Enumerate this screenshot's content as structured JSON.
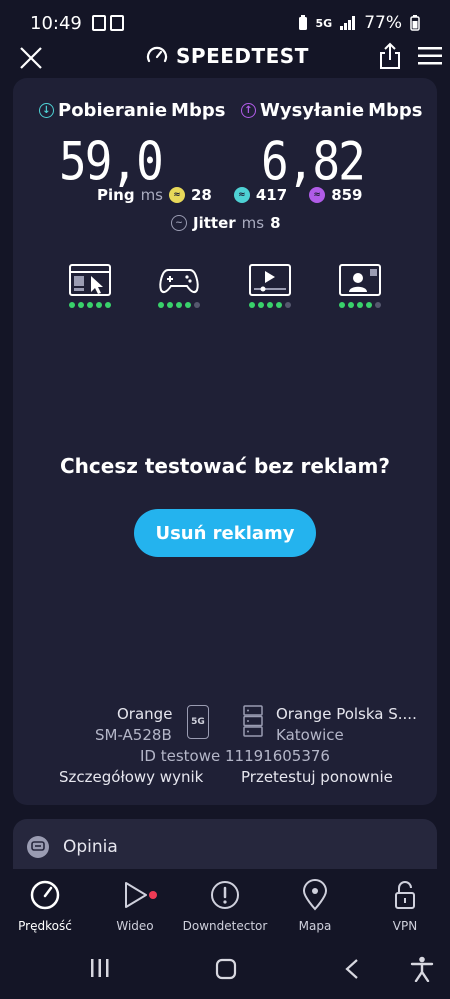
{
  "status_bar": {
    "time": "10:49",
    "network": "5G",
    "battery": "77%"
  },
  "header": {
    "title": "SPEEDTEST",
    "icons": [
      "close-icon",
      "speedometer-icon",
      "share-icon",
      "menu-icon"
    ]
  },
  "results": {
    "download": {
      "label": "Pobieranie",
      "unit": "Mbps",
      "value": "59,0",
      "color": "#4ed1d4"
    },
    "upload": {
      "label": "Wysyłanie",
      "unit": "Mbps",
      "value": "6,82",
      "color": "#b05ce8"
    },
    "ping": {
      "label": "Ping",
      "unit": "ms",
      "idle": "28",
      "download": "417",
      "upload": "859"
    },
    "jitter": {
      "label": "Jitter",
      "unit": "ms",
      "value": "8"
    }
  },
  "quality_indicators": [
    {
      "name": "browsing",
      "icon": "browser-cursor-icon",
      "level": 5,
      "max": 5
    },
    {
      "name": "gaming",
      "icon": "gamepad-icon",
      "level": 4,
      "max": 5
    },
    {
      "name": "video",
      "icon": "video-player-icon",
      "level": 4,
      "max": 5
    },
    {
      "name": "video-call",
      "icon": "video-call-icon",
      "level": 4,
      "max": 5
    }
  ],
  "promo": {
    "text": "Chcesz testować bez reklam?",
    "button": "Usuń reklamy"
  },
  "connection": {
    "provider": "Orange",
    "device": "SM-A528B",
    "device_badge": "5G",
    "server_name": "Orange Polska S....",
    "server_city": "Katowice",
    "test_id": "ID testowe 11191605376",
    "detail_link": "Szczegółowy wynik",
    "retest_link": "Przetestuj ponownie"
  },
  "feedback": {
    "label": "Opinia"
  },
  "bottom_nav": [
    {
      "label": "Prędkość",
      "icon": "speedometer-icon",
      "active": true
    },
    {
      "label": "Wideo",
      "icon": "play-icon",
      "active": false,
      "badge": true
    },
    {
      "label": "Downdetector",
      "icon": "alert-icon",
      "active": false
    },
    {
      "label": "Mapa",
      "icon": "map-pin-icon",
      "active": false
    },
    {
      "label": "VPN",
      "icon": "lock-icon",
      "active": false
    }
  ],
  "colors": {
    "background": "#141526",
    "card": "#1f2036",
    "accent": "#24b3ee",
    "quality_on": "#39d26b",
    "badge": "#ef3b55"
  }
}
